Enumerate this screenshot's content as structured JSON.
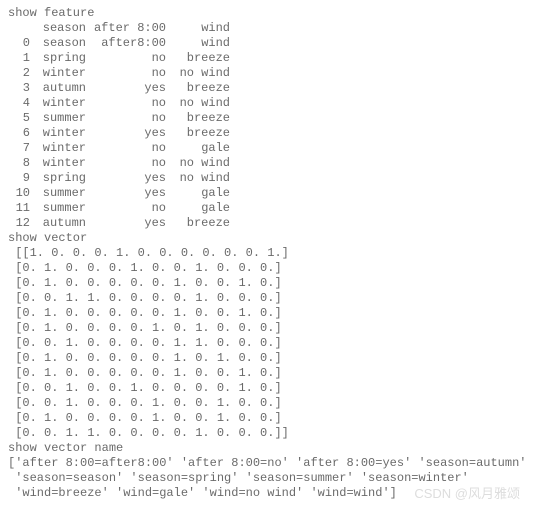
{
  "labels": {
    "show_feature": "show feature",
    "show_vector": "show vector",
    "show_vector_name": "show vector name"
  },
  "header_line1": {
    "idx": "",
    "season": "season",
    "after": "after 8:00",
    "wind": "wind"
  },
  "header_line0": {
    "idx": "0",
    "season": "season",
    "after": "after8:00",
    "wind": "wind"
  },
  "feature_rows": [
    {
      "idx": "1",
      "season": "spring",
      "after": "no",
      "wind": "breeze"
    },
    {
      "idx": "2",
      "season": "winter",
      "after": "no",
      "wind": "no wind"
    },
    {
      "idx": "3",
      "season": "autumn",
      "after": "yes",
      "wind": "breeze"
    },
    {
      "idx": "4",
      "season": "winter",
      "after": "no",
      "wind": "no wind"
    },
    {
      "idx": "5",
      "season": "summer",
      "after": "no",
      "wind": "breeze"
    },
    {
      "idx": "6",
      "season": "winter",
      "after": "yes",
      "wind": "breeze"
    },
    {
      "idx": "7",
      "season": "winter",
      "after": "no",
      "wind": "gale"
    },
    {
      "idx": "8",
      "season": "winter",
      "after": "no",
      "wind": "no wind"
    },
    {
      "idx": "9",
      "season": "spring",
      "after": "yes",
      "wind": "no wind"
    },
    {
      "idx": "10",
      "season": "summer",
      "after": "yes",
      "wind": "gale"
    },
    {
      "idx": "11",
      "season": "summer",
      "after": "no",
      "wind": "gale"
    },
    {
      "idx": "12",
      "season": "autumn",
      "after": "yes",
      "wind": "breeze"
    }
  ],
  "vector_lines": [
    " [[1. 0. 0. 0. 1. 0. 0. 0. 0. 0. 0. 1.]",
    " [0. 1. 0. 0. 0. 1. 0. 0. 1. 0. 0. 0.]",
    " [0. 1. 0. 0. 0. 0. 0. 1. 0. 0. 1. 0.]",
    " [0. 0. 1. 1. 0. 0. 0. 0. 1. 0. 0. 0.]",
    " [0. 1. 0. 0. 0. 0. 0. 1. 0. 0. 1. 0.]",
    " [0. 1. 0. 0. 0. 0. 1. 0. 1. 0. 0. 0.]",
    " [0. 0. 1. 0. 0. 0. 0. 1. 1. 0. 0. 0.]",
    " [0. 1. 0. 0. 0. 0. 0. 1. 0. 1. 0. 0.]",
    " [0. 1. 0. 0. 0. 0. 0. 1. 0. 0. 1. 0.]",
    " [0. 0. 1. 0. 0. 1. 0. 0. 0. 0. 1. 0.]",
    " [0. 0. 1. 0. 0. 0. 1. 0. 0. 1. 0. 0.]",
    " [0. 1. 0. 0. 0. 0. 1. 0. 0. 1. 0. 0.]",
    " [0. 0. 1. 1. 0. 0. 0. 0. 1. 0. 0. 0.]]"
  ],
  "vector_name_lines": [
    "['after 8:00=after8:00' 'after 8:00=no' 'after 8:00=yes' 'season=autumn'",
    " 'season=season' 'season=spring' 'season=summer' 'season=winter'",
    " 'wind=breeze' 'wind=gale' 'wind=no wind' 'wind=wind']"
  ],
  "watermark": "CSDN @风月雅颂"
}
